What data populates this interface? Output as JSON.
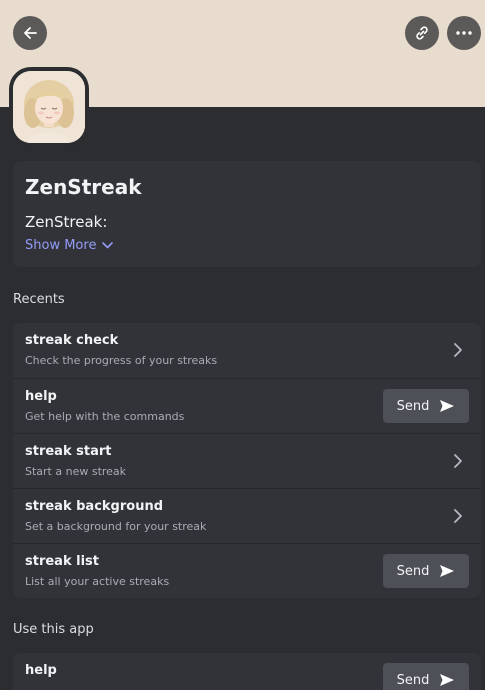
{
  "app": {
    "name": "ZenStreak",
    "description": "ZenStreak:",
    "show_more_label": "Show More"
  },
  "sections": {
    "recents_title": "Recents",
    "use_app_title": "Use this app"
  },
  "recents": [
    {
      "name": "streak check",
      "description": "Check the progress of your streaks",
      "action": "chevron"
    },
    {
      "name": "help",
      "description": "Get help with the commands",
      "action": "send"
    },
    {
      "name": "streak start",
      "description": "Start a new streak",
      "action": "chevron"
    },
    {
      "name": "streak background",
      "description": "Set a background for your streak",
      "action": "chevron"
    },
    {
      "name": "streak list",
      "description": "List all your active streaks",
      "action": "send"
    }
  ],
  "use_app": [
    {
      "name": "help",
      "action": "send"
    }
  ],
  "send_label": "Send",
  "icons": [
    "back-arrow-icon",
    "link-icon",
    "more-icon",
    "chevron-right-icon",
    "send-arrow-icon",
    "chevron-down-icon"
  ],
  "colors": {
    "banner": "#e8dcce",
    "background": "#2b2d31",
    "card": "#313338",
    "link": "#949cf7",
    "send_button": "#4e5058"
  }
}
